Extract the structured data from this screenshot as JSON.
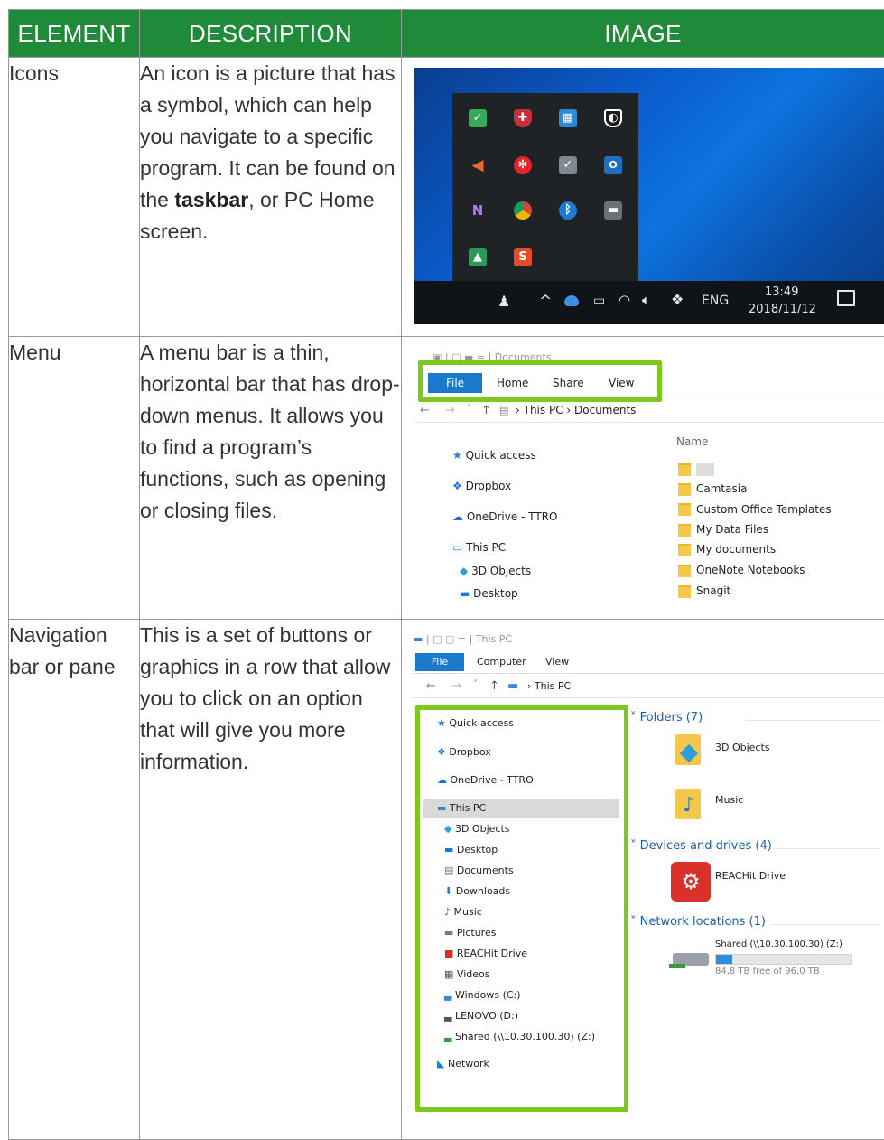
{
  "table": {
    "headers": [
      "ELEMENT",
      "DESCRIPTION",
      "IMAGE"
    ],
    "rows": [
      {
        "element": "Icons",
        "desc_parts": [
          "An icon is a picture that has a symbol, which can help you navigate to a specific program. It can be found on the ",
          "taskbar",
          ", or PC Home screen."
        ]
      },
      {
        "element": "Menu",
        "desc": "A menu bar is a thin, horizontal bar that has drop-down menus. It allows you to find a program’s functions, such as opening or closing files."
      },
      {
        "element": "Navigation bar or pane",
        "desc": "This is a set of buttons or graphics in a row that allow you to click on an option that will give you more information."
      }
    ]
  },
  "tray": {
    "lang": "ENG",
    "time": "13:49",
    "date": "2018/11/12",
    "chevron": "^",
    "icons": [
      "check-icon",
      "shield-icon",
      "monitor-icon",
      "defender-icon",
      "speaker-icon",
      "snowflake-icon",
      "drive-icon",
      "outlook-icon",
      "onenote-icon",
      "chrome-icon",
      "bluetooth-icon",
      "display-icon",
      "vm-icon",
      "snagit-icon"
    ],
    "outlook_text": "O",
    "onenote_text": "N",
    "snagit_text": "S"
  },
  "menu_shot": {
    "title": "Documents",
    "tabs": [
      "File",
      "Home",
      "Share",
      "View"
    ],
    "breadcrumb": [
      "This PC",
      "Documents"
    ],
    "name_header": "Name",
    "nav": [
      "Quick access",
      "Dropbox",
      "OneDrive - TTRO",
      "This PC",
      "3D Objects",
      "Desktop"
    ],
    "files": [
      "Camtasia",
      "Custom Office Templates",
      "My Data Files",
      "My documents",
      "OneNote Notebooks",
      "Snagit"
    ]
  },
  "nav_shot": {
    "title": "This PC",
    "tabs": [
      "File",
      "Computer",
      "View"
    ],
    "breadcrumb": [
      "This PC"
    ],
    "nav": [
      "Quick access",
      "Dropbox",
      "OneDrive - TTRO",
      "This PC",
      "3D Objects",
      "Desktop",
      "Documents",
      "Downloads",
      "Music",
      "Pictures",
      "REACHit Drive",
      "Videos",
      "Windows (C:)",
      "LENOVO (D:)",
      "Shared (\\\\10.30.100.30) (Z:)",
      "Network"
    ],
    "folders_header": "Folders (7)",
    "folders": [
      "3D Objects",
      "Music"
    ],
    "devices_header": "Devices and drives (4)",
    "device": "REACHit Drive",
    "network_header": "Network locations (1)",
    "network_drive": "Shared (\\\\10.30.100.30) (Z:)",
    "network_space": "84,8 TB free of 96,0 TB",
    "network_fill": 0.12
  },
  "colors": {
    "header_green": "#1e8a3a",
    "highlight_green": "#7dc81e",
    "file_tab_blue": "#1979ca"
  }
}
